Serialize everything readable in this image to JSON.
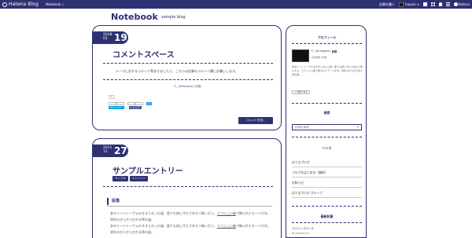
{
  "topbar": {
    "logo_text": "Hatena Blog",
    "blog_selector": "Notebook",
    "write_label": "記事を書く",
    "user_name": "hayani",
    "hatena_label": "Hatena"
  },
  "blog": {
    "title": "Notebook",
    "description": "sample blog"
  },
  "entries": [
    {
      "year": "2038",
      "month": "01",
      "day": "19",
      "title": "コメントスペース",
      "body": "テーマに対するコメント等ありましたら、こちらの記事のコメント欄にお願いします。",
      "author": "F_ (id:hayani) 2日前",
      "share_tag": "B!",
      "share": [
        {
          "count": "0",
          "label": "Bブックマーク"
        },
        {
          "count": "0",
          "label": "f シェア"
        },
        {
          "count": "",
          "label": "ツイート"
        }
      ],
      "comment_button": "コメントを書く"
    },
    {
      "year": "2011",
      "month": "12",
      "day": "27",
      "title": "サンプルエントリー",
      "categories": [
        "サンプル",
        "エントリー"
      ],
      "heading": "段落",
      "para1_a": "あのイーハトーヴォのすきとおった風、夏でも底に冷たさをもつ青いそら、",
      "para1_link": "うつくしい森",
      "para1_b": "で飾られたモーリオ市、郊外のぎらぎらひかる草の波。",
      "para2_a": "あのイーハトーヴォのすきとおった風、夏でも底に冷たさをもつ青いそら、",
      "para2_link": "うつくしい森",
      "para2_b": "で飾られたモーリオ市、郊外のぎらぎらひかる草の波。"
    }
  ],
  "sidebar": {
    "profile_heading": "プロフィール",
    "profile_name": "F_ (id:hayani)",
    "profile_badge": "Pro",
    "profile_since": "読者登録 3年前",
    "profile_desc": "あのイーハトーヴォのすきとおった風、夏でも底に冷たさをもつ青いそら、うつくしい森で飾られたモーリオ市、郊外のぎらぎら光る草の波。",
    "follow_button": "+ 読者になる",
    "search_heading": "検索",
    "search_placeholder": "記事を検索",
    "links_heading": "リンク",
    "links": [
      "はてなブログ",
      "ブログをはじめる（無料）",
      "お知らせ",
      "はてなブログ グループ"
    ],
    "recent_heading": "最新記事",
    "recent": [
      {
        "title": "コメントスペース",
        "date": "年 2038-01-19"
      }
    ]
  },
  "colors": {
    "brand": "#2d3172",
    "background": "#ffffff"
  }
}
